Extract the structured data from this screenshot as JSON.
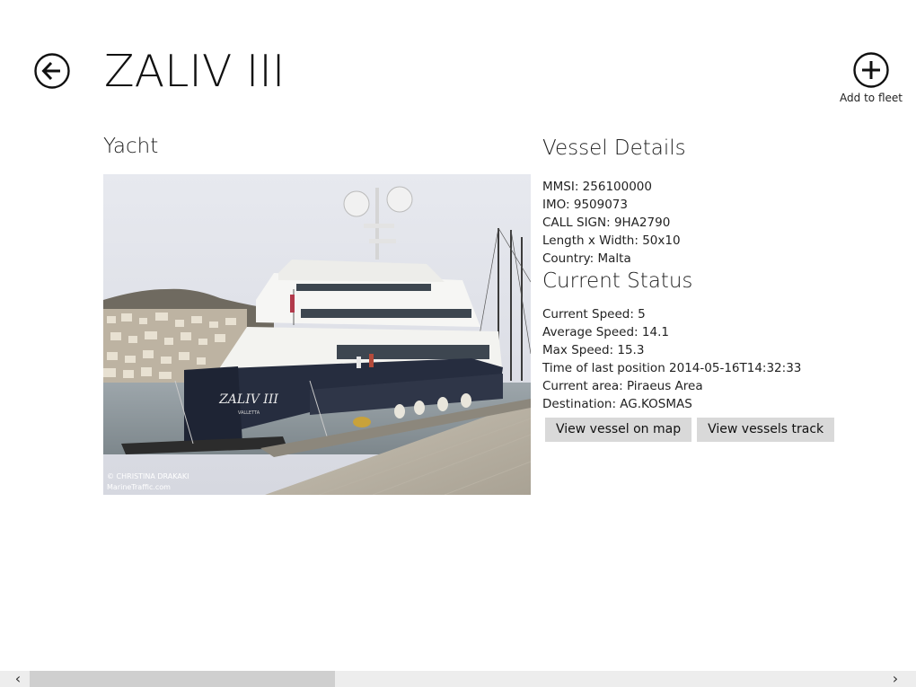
{
  "header": {
    "title": "ZALIV III",
    "add_to_fleet_label": "Add to fleet",
    "back_icon": "arrow-left-circle",
    "add_icon": "plus-circle"
  },
  "vessel": {
    "type": "Yacht",
    "photo_credit_line1": "© CHRISTINA DRAKAKI",
    "photo_credit_line2": "MarineTraffic.com",
    "hull_name": "ZALIV III",
    "hull_port": "VALLETTA"
  },
  "details": {
    "heading": "Vessel Details",
    "mmsi": "MMSI: 256100000",
    "imo": "IMO: 9509073",
    "call_sign": "CALL SIGN: 9HA2790",
    "dimensions": "Length x Width: 50x10",
    "country": "Country: Malta"
  },
  "status": {
    "heading": "Current Status",
    "current_speed": "Current Speed: 5",
    "average_speed": "Average Speed: 14.1",
    "max_speed": "Max Speed: 15.3",
    "last_position": "Time of last position 2014-05-16T14:32:33",
    "current_area": "Current area: Piraeus Area",
    "destination": "Destination: AG.KOSMAS"
  },
  "actions": {
    "view_on_map": "View vessel on map",
    "view_track": "View vessels track"
  },
  "scrollbar": {
    "left_arrow": "‹",
    "right_arrow": "›"
  }
}
